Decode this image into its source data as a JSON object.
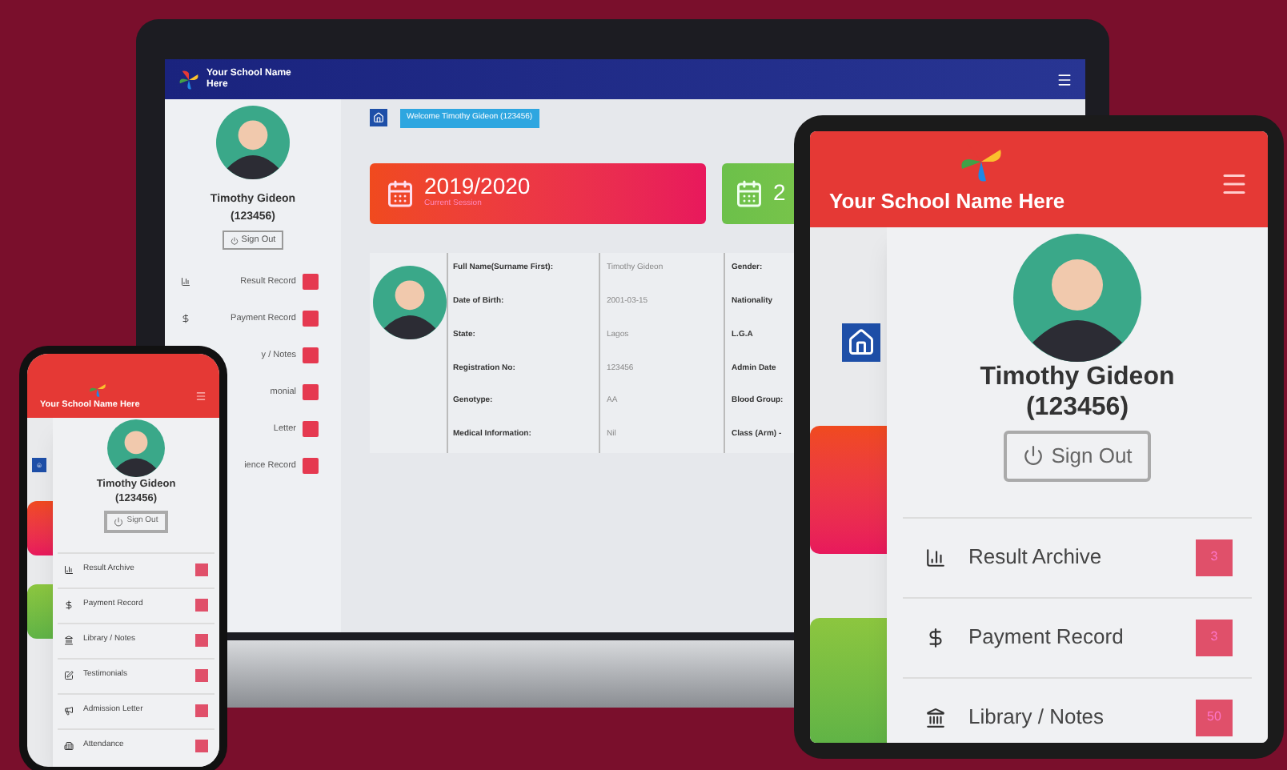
{
  "laptop": {
    "school_name": "Your School Name Here",
    "sidebar": {
      "student_name": "Timothy Gideon",
      "student_id": "(123456)",
      "sign_out": "Sign Out",
      "items": [
        {
          "label": "Result Record"
        },
        {
          "label": "Payment Record"
        },
        {
          "label": "y / Notes"
        },
        {
          "label": "monial"
        },
        {
          "label": "Letter"
        },
        {
          "label": "ience Record"
        }
      ]
    },
    "breadcrumb": "Welcome Timothy Gideon (123456)",
    "session_card": {
      "value": "2019/2020",
      "label": "Current Session"
    },
    "term_card": {
      "value": "2"
    },
    "profile_rows": [
      {
        "label": "Full Name(Surname First):",
        "value": "Timothy Gideon",
        "label_2": "Gender:"
      },
      {
        "label": "Date of Birth:",
        "value": "2001-03-15",
        "label_2": "Nationality"
      },
      {
        "label": "State:",
        "value": "Lagos",
        "label_2": "L.G.A"
      },
      {
        "label": "Registration No:",
        "value": "123456",
        "label_2": "Admin Date"
      },
      {
        "label": "Genotype:",
        "value": "AA",
        "label_2": "Blood Group:"
      },
      {
        "label": "Medical Information:",
        "value": "Nil",
        "label_2": "Class (Arm) -"
      }
    ]
  },
  "tablet": {
    "school_name": "Your School Name Here",
    "student_name": "Timothy Gideon",
    "student_id": "(123456)",
    "sign_out": "Sign Out",
    "items": [
      {
        "label": "Result Archive",
        "count": "3"
      },
      {
        "label": "Payment Record",
        "count": "3"
      },
      {
        "label": "Library / Notes",
        "count": "50"
      }
    ]
  },
  "phone": {
    "school_name": "Your School Name Here",
    "student_name": "Timothy Gideon",
    "student_id": "(123456)",
    "sign_out": "Sign Out",
    "items": [
      {
        "label": "Result Archive"
      },
      {
        "label": "Payment Record"
      },
      {
        "label": "Library / Notes"
      },
      {
        "label": "Testimonials"
      },
      {
        "label": "Admission Letter"
      },
      {
        "label": "Attendance"
      }
    ]
  }
}
